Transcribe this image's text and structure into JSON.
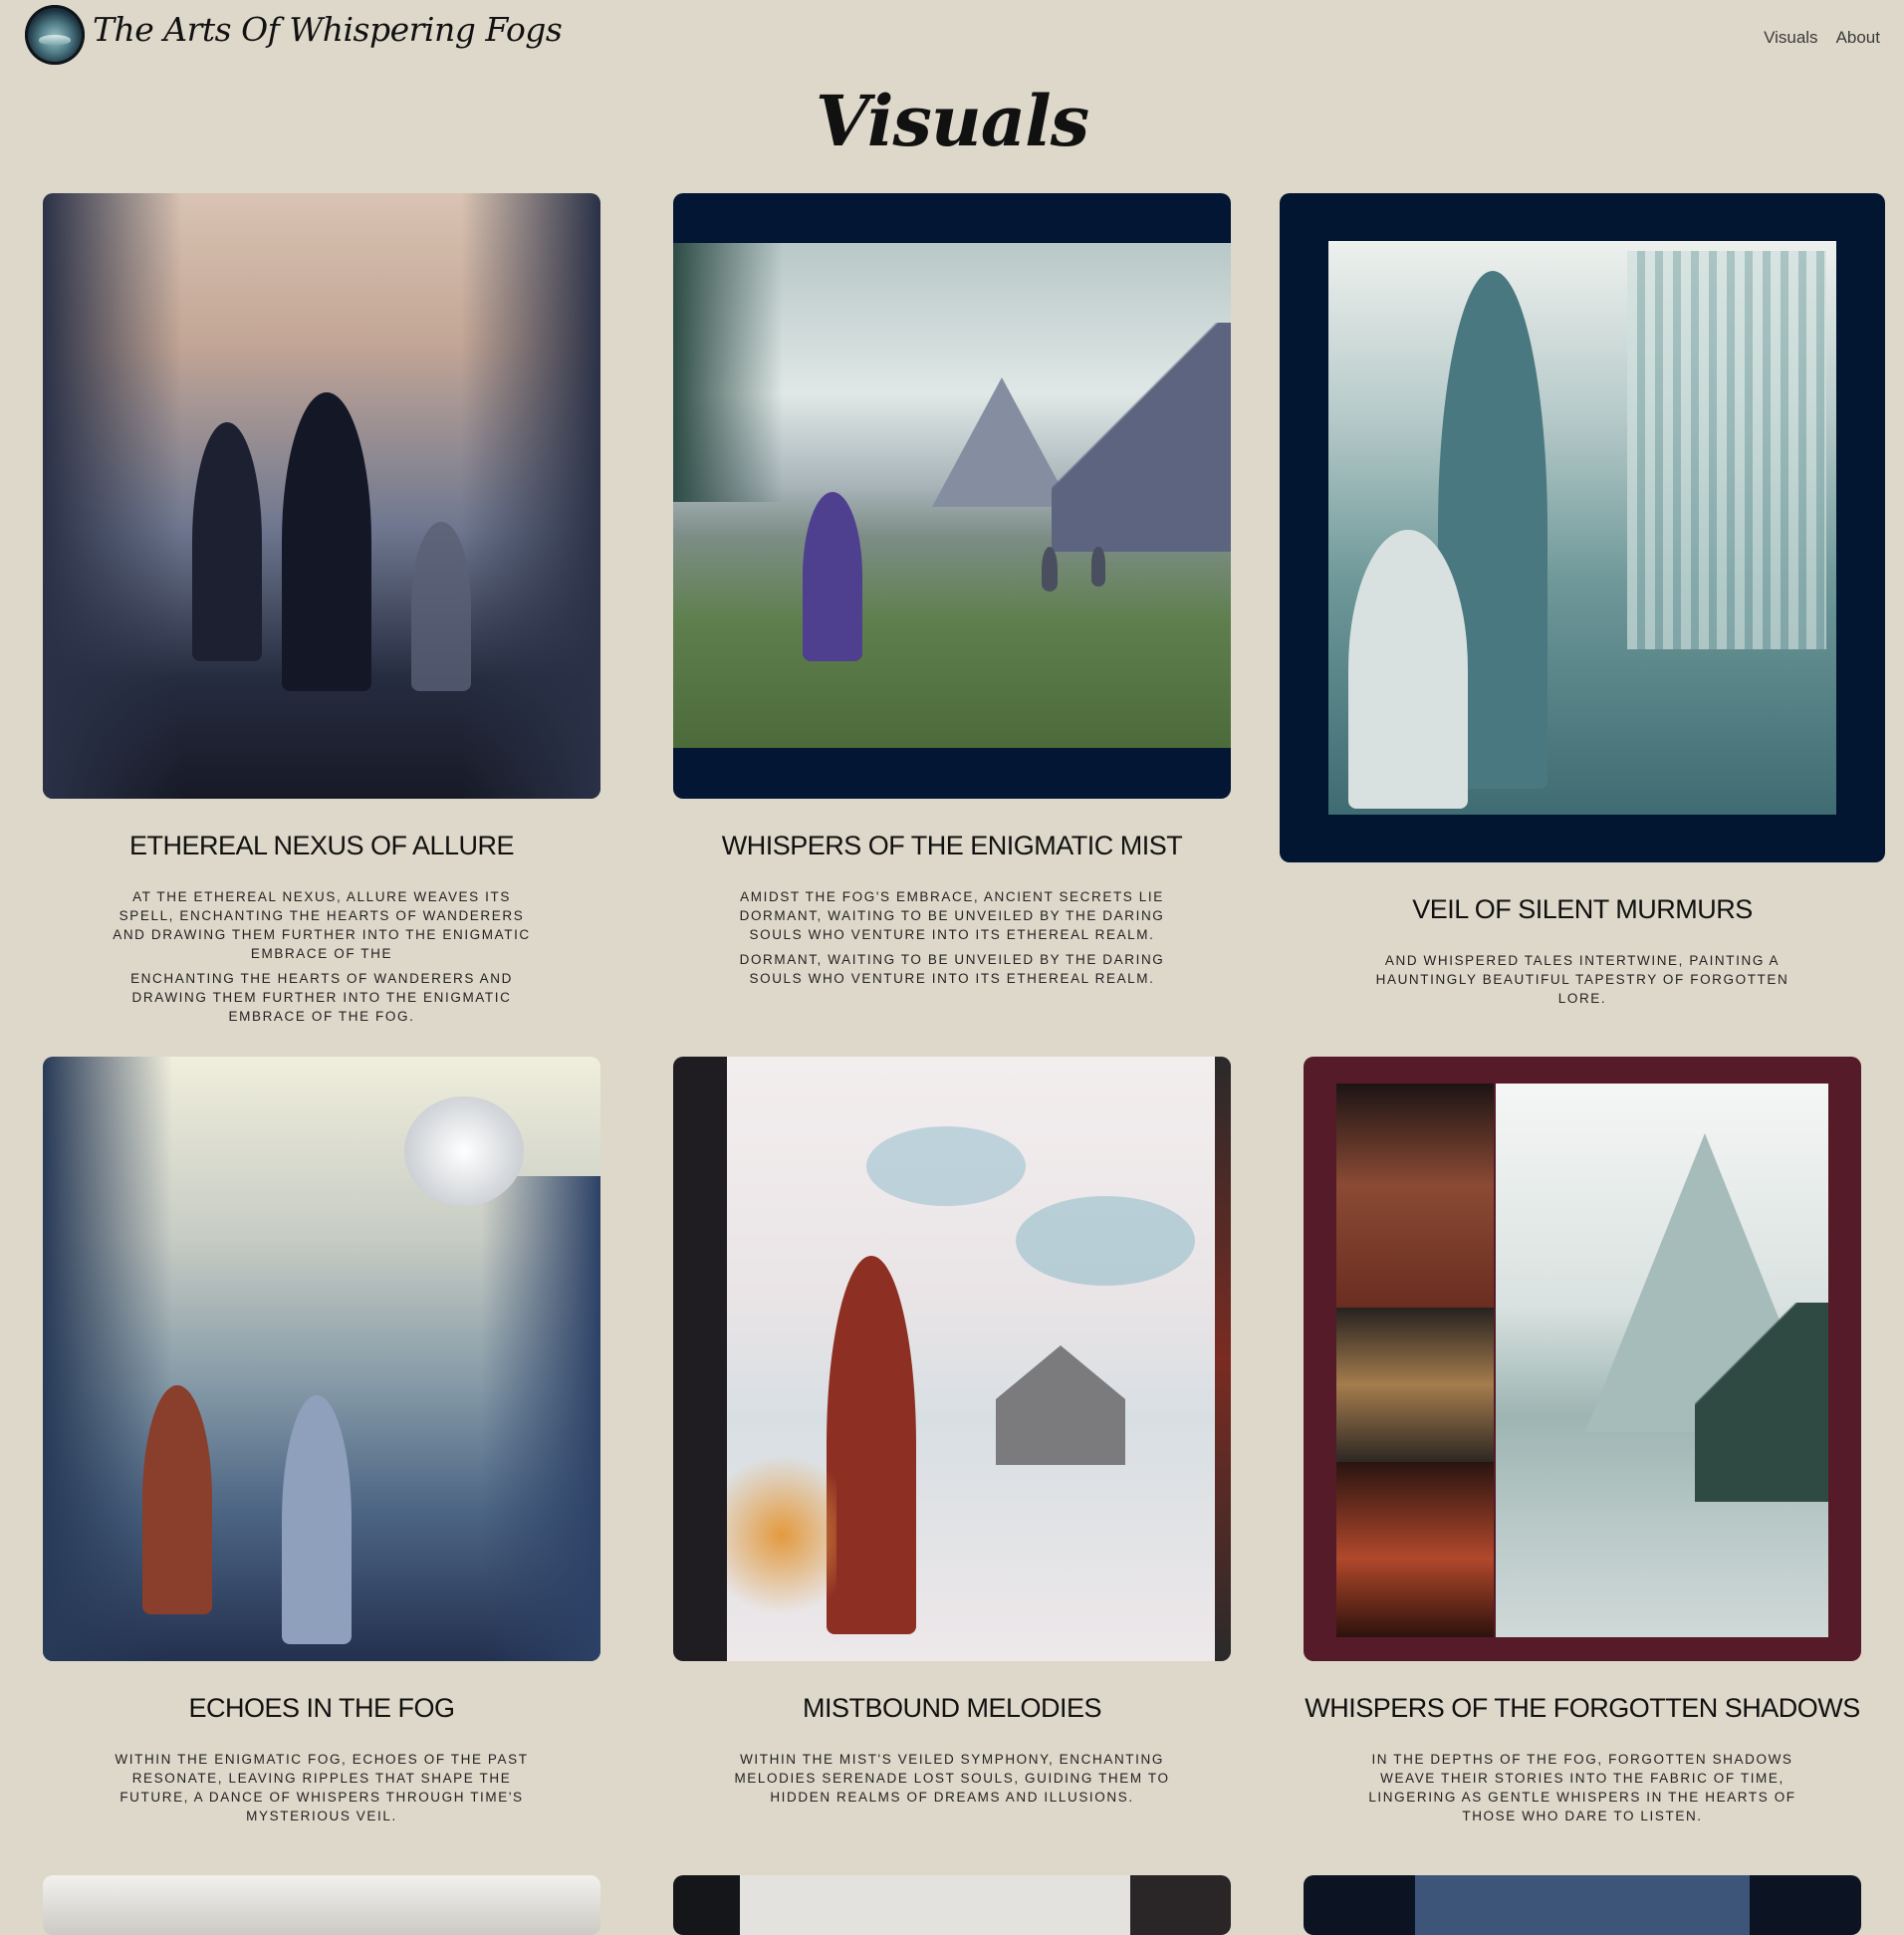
{
  "site": {
    "title": "The Arts Of Whispering Fogs"
  },
  "nav": {
    "items": [
      "Visuals",
      "About"
    ]
  },
  "page": {
    "title": "Visuals"
  },
  "cards": [
    {
      "title": "ETHEREAL NEXUS OF ALLURE",
      "desc": [
        "AT THE ETHEREAL NEXUS, ALLURE WEAVES ITS SPELL, ENCHANTING THE HEARTS OF WANDERERS AND DRAWING THEM FURTHER INTO THE ENIGMATIC EMBRACE OF THE",
        "ENCHANTING THE HEARTS OF WANDERERS AND DRAWING THEM FURTHER INTO THE ENIGMATIC EMBRACE OF THE FOG."
      ]
    },
    {
      "title": "WHISPERS OF THE ENIGMATIC MIST",
      "desc": [
        "AMIDST THE FOG'S EMBRACE, ANCIENT SECRETS LIE DORMANT, WAITING TO BE UNVEILED BY THE DARING SOULS WHO VENTURE INTO ITS ETHEREAL REALM.",
        "DORMANT, WAITING TO BE UNVEILED BY THE DARING SOULS WHO VENTURE INTO ITS ETHEREAL REALM."
      ]
    },
    {
      "title": "VEIL OF SILENT MURMURS",
      "desc": [
        "AND WHISPERED TALES INTERTWINE, PAINTING A HAUNTINGLY BEAUTIFUL TAPESTRY OF FORGOTTEN LORE."
      ]
    },
    {
      "title": "ECHOES IN THE FOG",
      "desc": [
        "WITHIN THE ENIGMATIC FOG, ECHOES OF THE PAST RESONATE, LEAVING RIPPLES THAT SHAPE THE FUTURE, A DANCE OF WHISPERS THROUGH TIME'S MYSTERIOUS VEIL."
      ]
    },
    {
      "title": "MISTBOUND MELODIES",
      "desc": [
        "WITHIN THE MIST'S VEILED SYMPHONY, ENCHANTING MELODIES SERENADE LOST SOULS, GUIDING THEM TO HIDDEN REALMS OF DREAMS AND ILLUSIONS."
      ]
    },
    {
      "title": "WHISPERS OF THE FORGOTTEN SHADOWS",
      "desc": [
        "IN THE DEPTHS OF THE FOG, FORGOTTEN SHADOWS WEAVE THEIR STORIES INTO THE FABRIC OF TIME, LINGERING AS GENTLE WHISPERS IN THE HEARTS OF THOSE WHO DARE TO LISTEN."
      ]
    }
  ]
}
